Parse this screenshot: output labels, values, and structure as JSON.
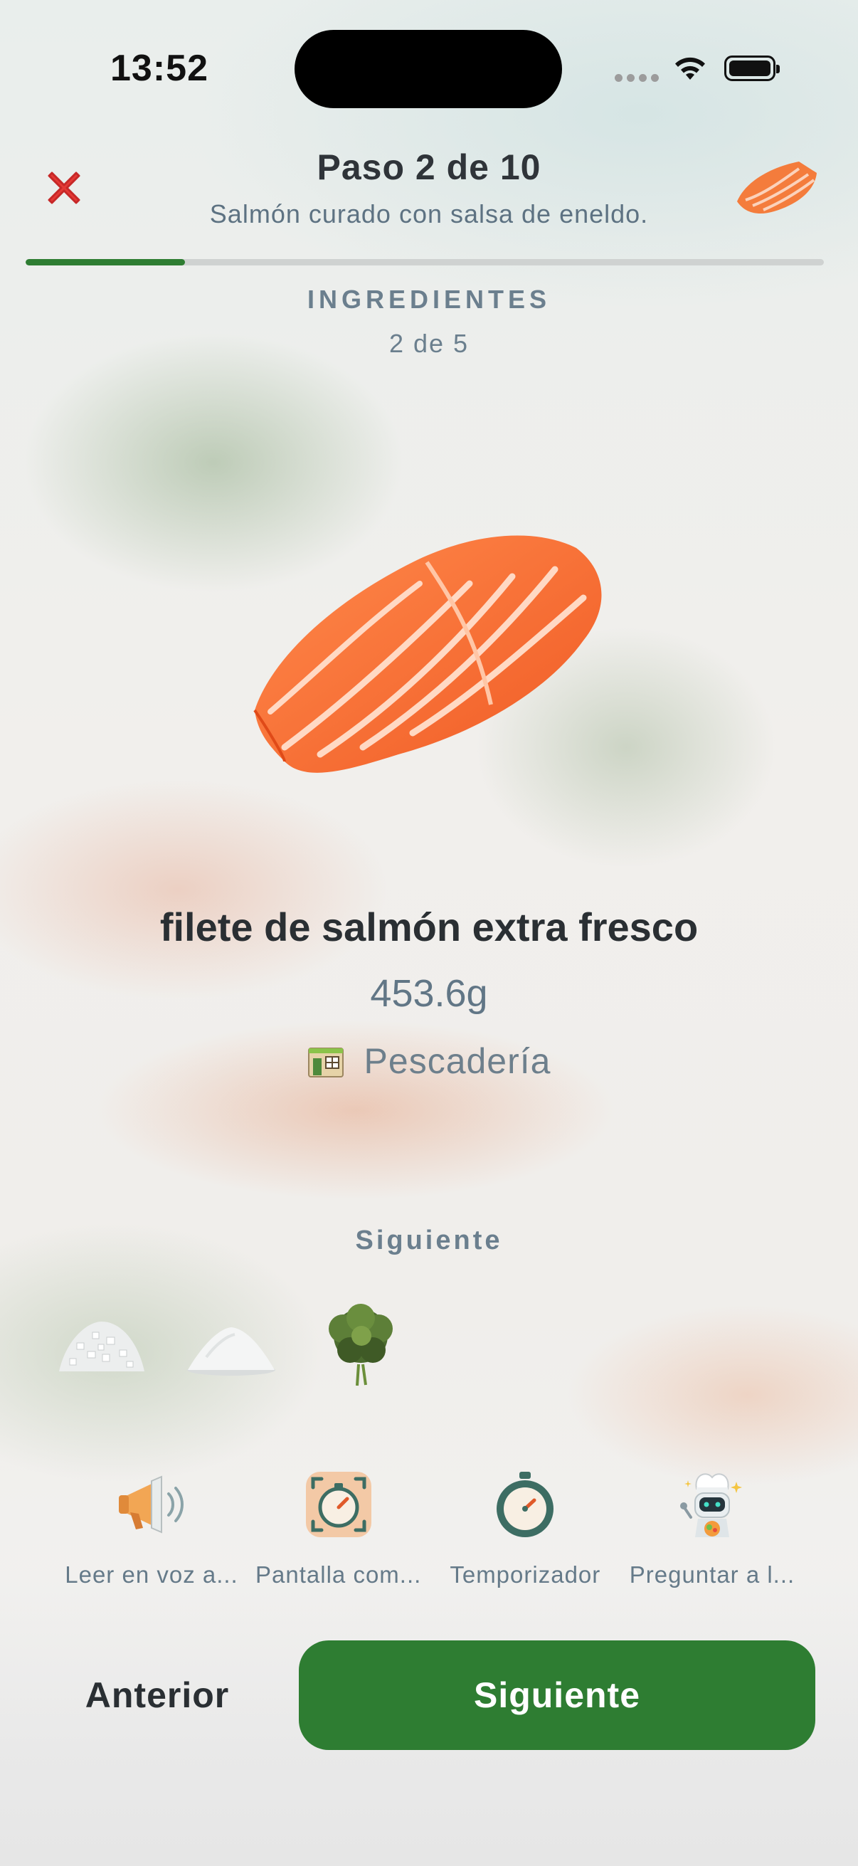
{
  "status_bar": {
    "time": "13:52"
  },
  "header": {
    "title": "Paso 2 de 10",
    "subtitle": "Salmón curado con salsa de eneldo.",
    "progress": 0.2
  },
  "section": {
    "label": "INGREDIENTES",
    "count": "2 de 5"
  },
  "ingredient": {
    "name": "filete de salmón extra fresco",
    "quantity": "453.6g",
    "store": "Pescadería",
    "image_icon": "salmon-fillet"
  },
  "next_section": {
    "label": "Siguiente",
    "items": [
      "coarse-salt",
      "sugar",
      "fresh-dill"
    ]
  },
  "tools": [
    {
      "label": "Leer en voz a...",
      "icon": "megaphone-icon"
    },
    {
      "label": "Pantalla com...",
      "icon": "screen-timer-icon"
    },
    {
      "label": "Temporizador",
      "icon": "stopwatch-icon"
    },
    {
      "label": "Preguntar a l...",
      "icon": "robot-chef-icon"
    }
  ],
  "nav": {
    "prev_label": "Anterior",
    "next_label": "Siguiente"
  },
  "colors": {
    "accent": "#2e7d32",
    "close": "#e53935",
    "text_muted": "#6b7f8e"
  }
}
